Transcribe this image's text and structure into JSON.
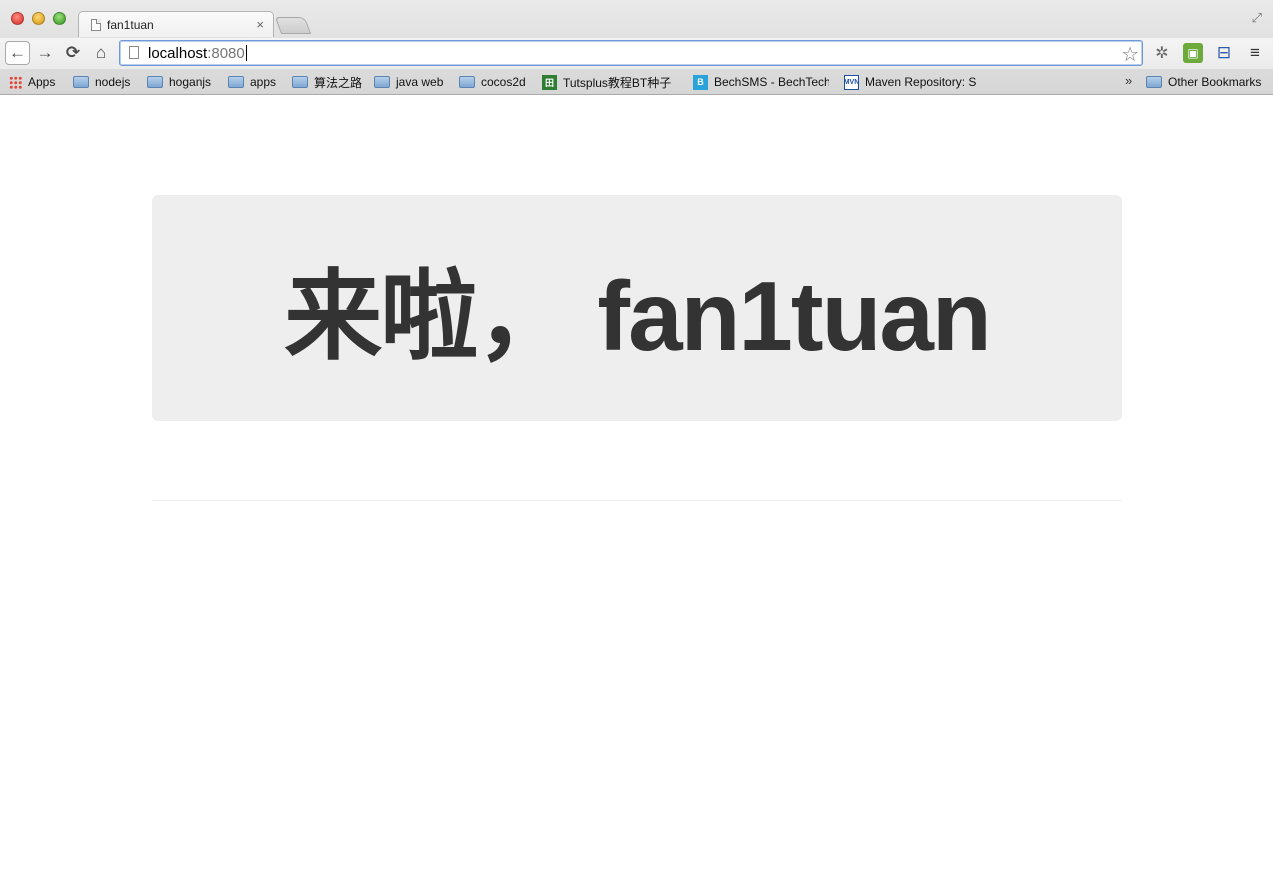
{
  "tab": {
    "title": "fan1tuan",
    "close": "×"
  },
  "toolbar": {
    "back": "←",
    "forward": "→",
    "reload": "⟳",
    "home": "⌂",
    "url_host": "localhost",
    "url_port": ":8080",
    "star": "☆",
    "menu": "≡"
  },
  "bookmarks": {
    "items": [
      {
        "label": "Apps",
        "icon": "apps-grid-icon"
      },
      {
        "label": "nodejs",
        "icon": "folder-icon"
      },
      {
        "label": "hoganjs",
        "icon": "folder-icon"
      },
      {
        "label": "apps",
        "icon": "folder-icon"
      },
      {
        "label": "算法之路",
        "icon": "folder-icon"
      },
      {
        "label": "java web",
        "icon": "folder-icon"
      },
      {
        "label": "cocos2d",
        "icon": "folder-icon"
      },
      {
        "label": "Tutsplus教程BT种子",
        "icon": "tutsplus-icon"
      },
      {
        "label": "BechSMS - BechTech",
        "icon": "bechsms-icon"
      },
      {
        "label": "Maven Repository: S",
        "icon": "maven-icon"
      },
      {
        "label": "Other Bookmarks",
        "icon": "folder-icon"
      }
    ],
    "more": "»"
  },
  "page": {
    "hero_title": "来啦， fan1tuan"
  },
  "colors": {
    "jumbotron_bg": "#eeeeee",
    "hero_text": "#333333"
  }
}
